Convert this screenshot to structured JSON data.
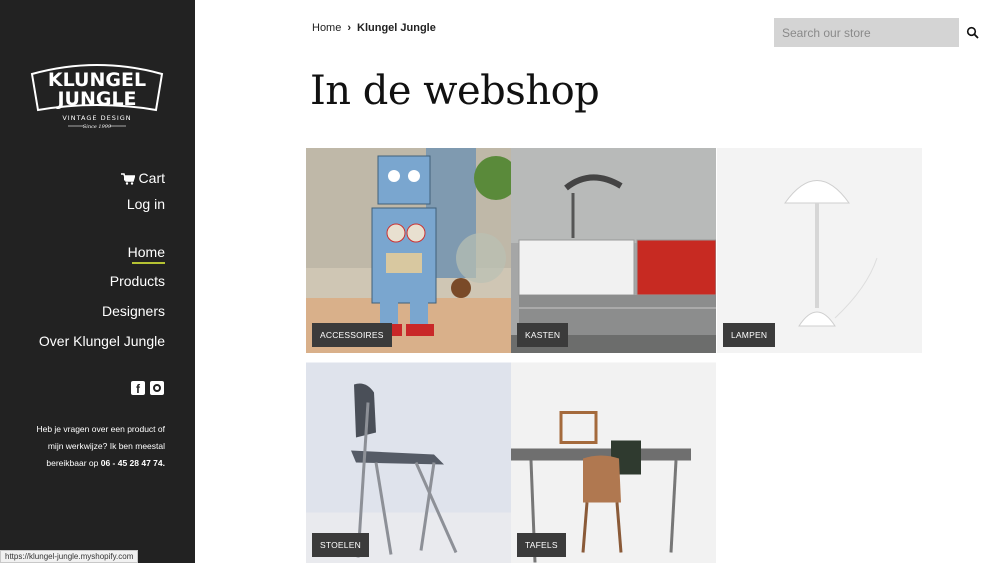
{
  "brand": {
    "logo_line1": "KLUNGEL",
    "logo_line2": "JUNGLE",
    "tagline": "VINTAGE DESIGN",
    "since": "Since 1999"
  },
  "sidebar": {
    "cart_label": "Cart",
    "login_label": "Log in",
    "nav": [
      {
        "label": "Home"
      },
      {
        "label": "Products"
      },
      {
        "label": "Designers"
      },
      {
        "label": "Over Klungel Jungle"
      }
    ],
    "contact_text": "Heb je vragen over een product of mijn werkwijze? Ik ben meestal bereikbaar op",
    "contact_phone": "06 - 45 28 47 74."
  },
  "status_bar": {
    "url": "https://klungel-jungle.myshopify.com"
  },
  "breadcrumb": {
    "home": "Home",
    "separator": "›",
    "current": "Klungel Jungle"
  },
  "search": {
    "placeholder": "Search our store"
  },
  "page": {
    "title": "In de webshop"
  },
  "collections": [
    {
      "label": "ACCESSOIRES"
    },
    {
      "label": "KASTEN"
    },
    {
      "label": "LAMPEN"
    },
    {
      "label": "STOELEN"
    },
    {
      "label": "TAFELS"
    }
  ],
  "colors": {
    "sidebar_bg": "#222222",
    "accent_underline": "#b5c233",
    "search_bg": "#d4d4d4",
    "label_bg": "#3b3b3b"
  }
}
